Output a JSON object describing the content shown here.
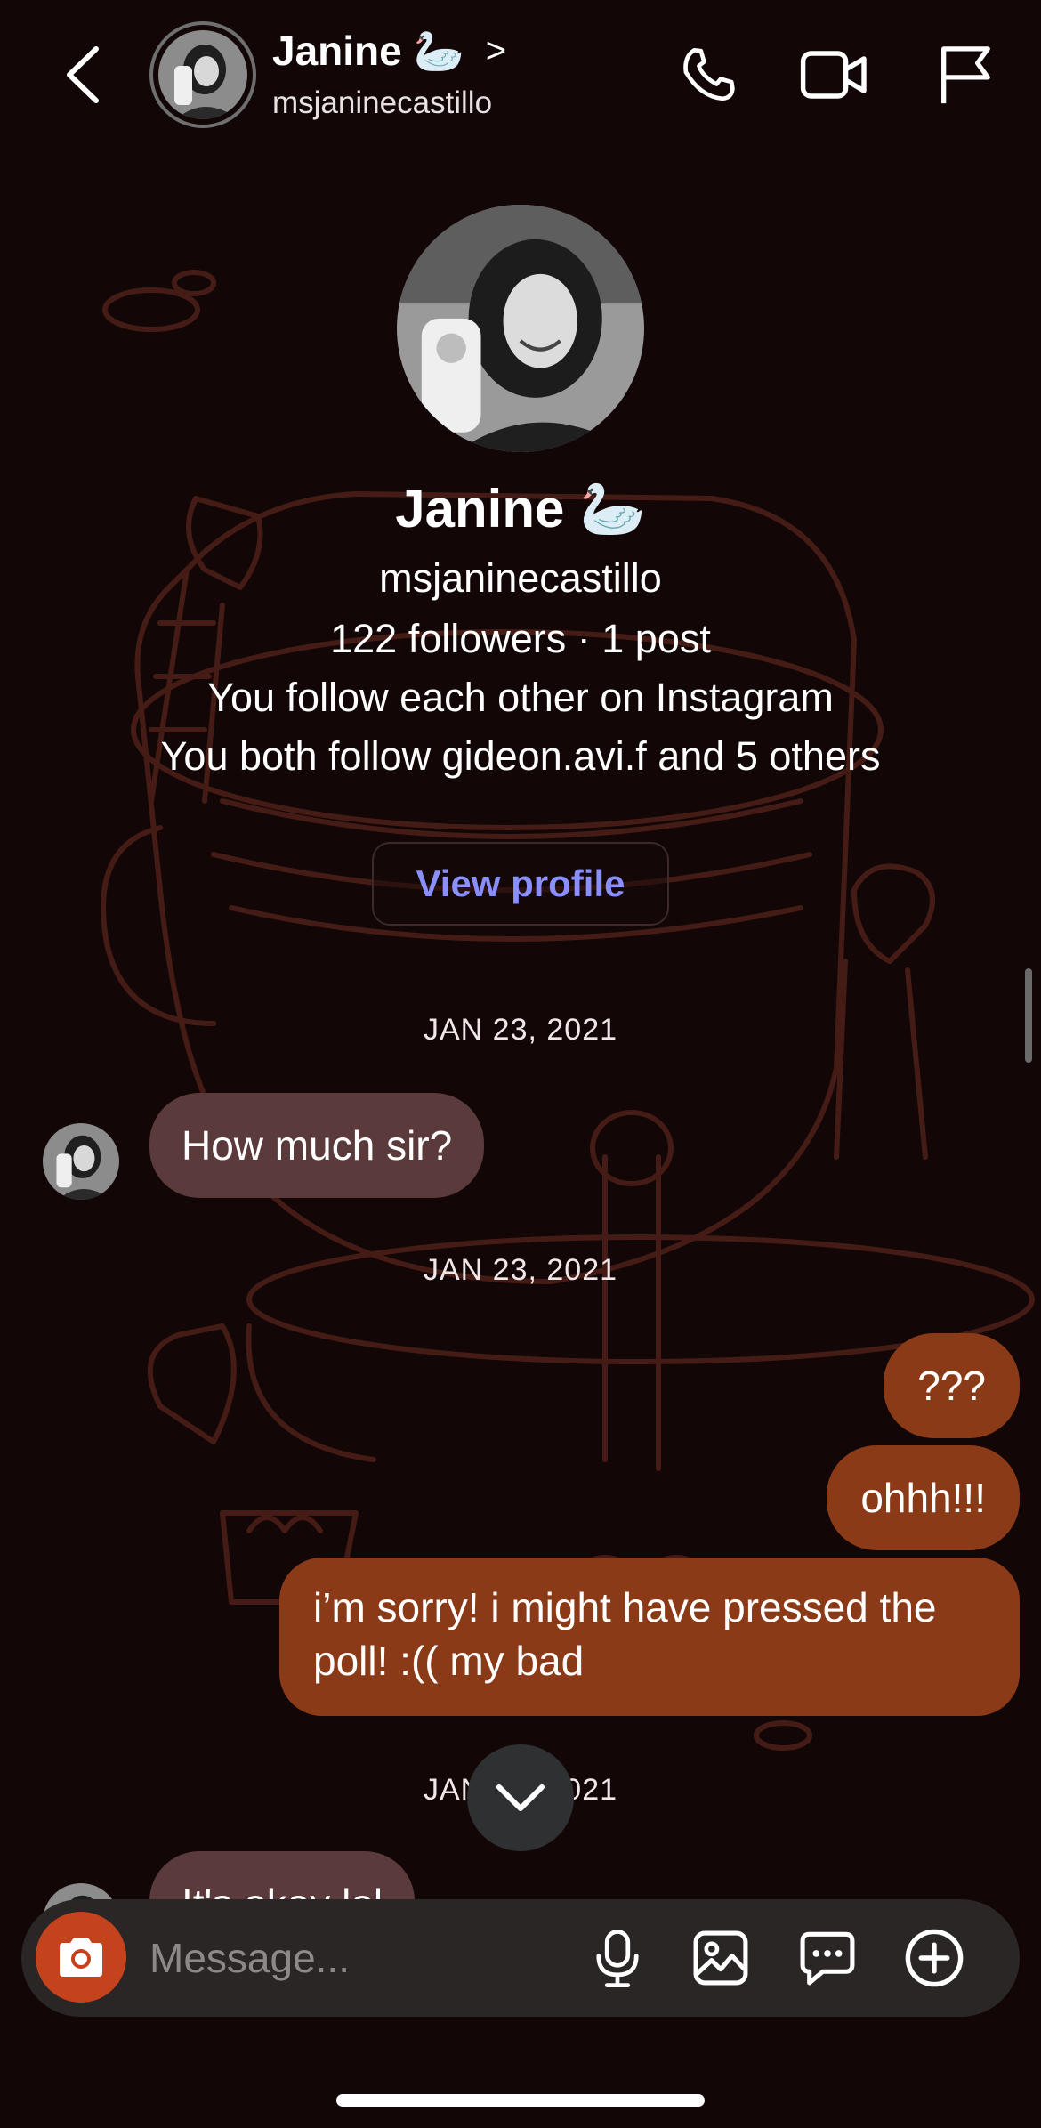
{
  "header": {
    "name": "Janine 🦢",
    "username": "msjaninecastillo",
    "chevron": ">"
  },
  "profile": {
    "name": "Janine 🦢",
    "username": "msjaninecastillo",
    "stats": "122 followers · 1 post",
    "follow_status": "You follow each other on Instagram",
    "mutual": "You both follow gideon.avi.f and 5 others",
    "view_profile_label": "View profile"
  },
  "thread": {
    "date_1": "JAN 23, 2021",
    "msg_in_1": "How much sir?",
    "date_2": "JAN 23, 2021",
    "msg_out_1": "???",
    "msg_out_2": "ohhh!!!",
    "msg_out_3": "i’m sorry! i might have pressed the poll! :(( my bad",
    "date_3": "JAN 23, 2021",
    "msg_in_2": "It's okay lol"
  },
  "composer": {
    "placeholder": "Message..."
  },
  "icons": {
    "back": "chevron-left-icon",
    "call": "phone-icon",
    "video": "video-camera-icon",
    "report": "flag-icon",
    "camera": "camera-icon",
    "mic": "microphone-icon",
    "gallery": "image-icon",
    "sticker": "chat-bubble-icon",
    "more": "plus-circle-icon",
    "scroll_down": "chevron-down-icon"
  },
  "colors": {
    "background": "#120607",
    "incoming_bubble": "#5a3a3a",
    "outgoing_bubble": "#8b3a17",
    "camera_button": "#c4421c",
    "link": "#8a8fff"
  }
}
